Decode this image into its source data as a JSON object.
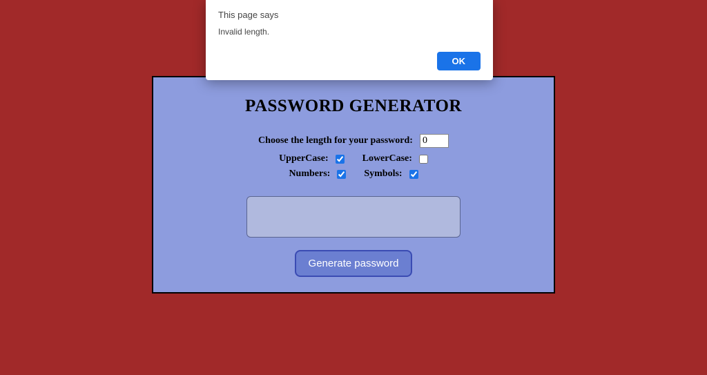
{
  "alert": {
    "title": "This page says",
    "message": "Invalid length.",
    "ok": "OK"
  },
  "card": {
    "title": "PASSWORD GENERATOR",
    "length_label": "Choose the length for your password:",
    "length_value": "0",
    "options": {
      "uppercase_label": "UpperCase:",
      "uppercase_checked": true,
      "lowercase_label": "LowerCase:",
      "lowercase_checked": false,
      "numbers_label": "Numbers:",
      "numbers_checked": true,
      "symbols_label": "Symbols:",
      "symbols_checked": true
    },
    "output_value": "",
    "generate_label": "Generate password"
  }
}
